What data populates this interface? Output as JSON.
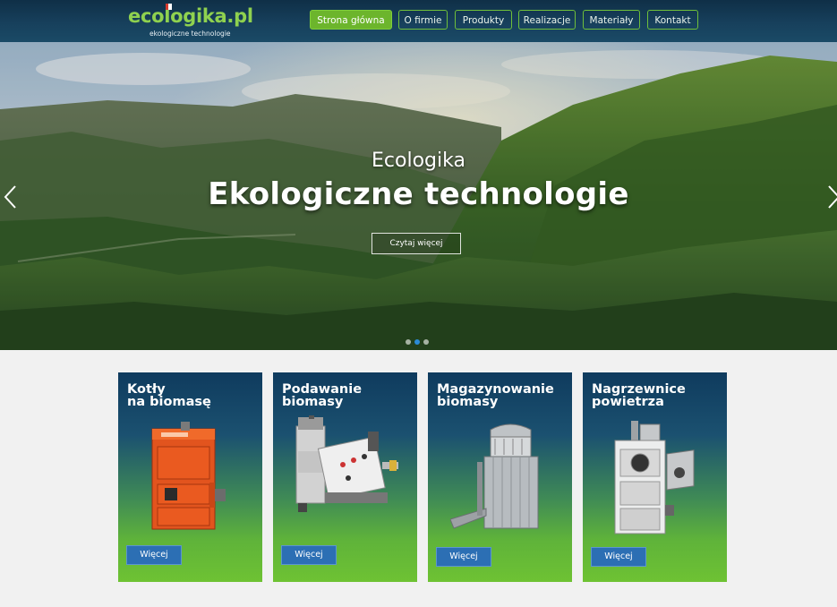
{
  "header": {
    "logo_name": "ecologika.pl",
    "logo_tagline": "ekologiczne technologie",
    "nav": [
      {
        "label": "Strona główna",
        "active": true
      },
      {
        "label": "O firmie",
        "active": false
      },
      {
        "label": "Produkty",
        "active": false
      },
      {
        "label": "Realizacje",
        "active": false
      },
      {
        "label": "Materiały",
        "active": false
      },
      {
        "label": "Kontakt",
        "active": false
      }
    ]
  },
  "hero": {
    "subtitle": "Ecologika",
    "title": "Ekologiczne technologie",
    "button": "Czytaj więcej",
    "slides_total": 3,
    "slide_active": 2
  },
  "cards": [
    {
      "title": "Kotły\nna biomasę",
      "button": "Więcej",
      "icon": "biomass-boiler-image"
    },
    {
      "title": "Podawanie\nbiomasy",
      "button": "Więcej",
      "icon": "biomass-feeder-image"
    },
    {
      "title": "Magazynowanie\nbiomasy",
      "button": "Więcej",
      "icon": "biomass-silo-image"
    },
    {
      "title": "Nagrzewnice\npowietrza",
      "button": "Więcej",
      "icon": "air-heater-image"
    }
  ],
  "colors": {
    "header_bg": "#17405c",
    "accent_green": "#6cb52c",
    "card_button": "#2c6fb4"
  }
}
